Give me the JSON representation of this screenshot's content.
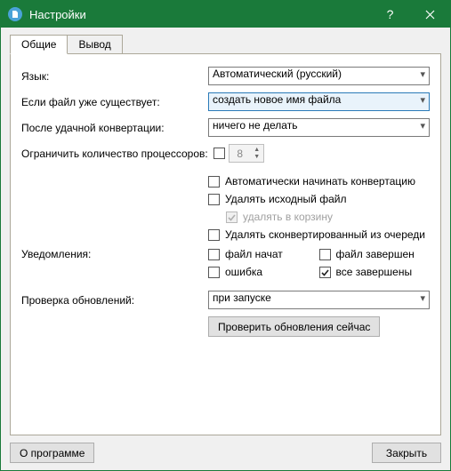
{
  "title": "Настройки",
  "tabs": {
    "general": "Общие",
    "output": "Вывод"
  },
  "labels": {
    "language": "Язык:",
    "ifFileExists": "Если файл уже существует:",
    "afterConvert": "После удачной конвертации:",
    "limitCPU": "Ограничить количество процессоров:",
    "notifications": "Уведомления:",
    "checkUpdates": "Проверка обновлений:"
  },
  "values": {
    "language": "Автоматический (русский)",
    "ifFileExists": "создать новое имя файла",
    "afterConvert": "ничего не делать",
    "cpuCount": "8",
    "checkUpdates": "при запуске"
  },
  "checks": {
    "autoStart": "Автоматически начинать конвертацию",
    "deleteSource": "Удалять исходный файл",
    "deleteToRecycle": "удалять в корзину",
    "removeFromQueue": "Удалять сконвертированный из очереди",
    "fileStarted": "файл начат",
    "fileFinished": "файл завершен",
    "error": "ошибка",
    "allFinished": "все завершены"
  },
  "buttons": {
    "checkNow": "Проверить обновления сейчас",
    "about": "О программе",
    "close": "Закрыть"
  }
}
